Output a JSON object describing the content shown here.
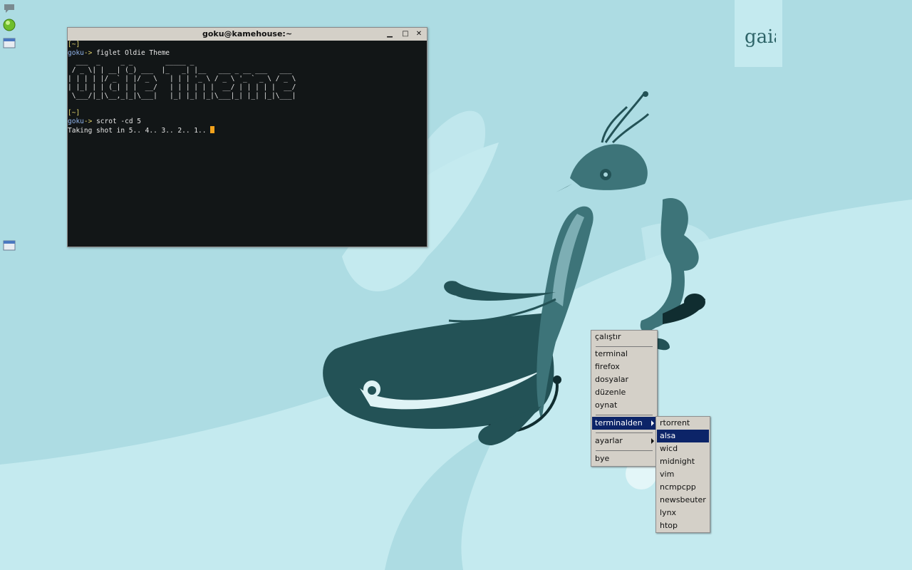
{
  "desktop": {
    "logo_text": "gaia"
  },
  "tray": {
    "icons": [
      "chat-icon",
      "green-orb-icon",
      "window-icon",
      "window-icon"
    ]
  },
  "terminal": {
    "title": "goku@kamehouse:~",
    "buttons": [
      "minimize",
      "maximize",
      "close"
    ],
    "lines": [
      {
        "prompt_dir": "[~]"
      },
      {
        "user": "goku",
        "arrow": "-> ",
        "cmd": "figlet Oldie Theme"
      },
      {
        "text": "  ___  _     _ _        _____ _"
      },
      {
        "text": " / _ \\| | __| (_) ___  |_   _| |__   ___ _ __ ___   ___"
      },
      {
        "text": "| | | | |/ _` | |/ _ \\   | | | '_ \\ / _ \\ '_ ` _ \\ / _ \\"
      },
      {
        "text": "| |_| | | (_| | |  __/   | | | | | |  __/ | | | | |  __/"
      },
      {
        "text": " \\___/|_|\\__,_|_|\\___|   |_| |_| |_|\\___|_| |_| |_|\\___|"
      },
      {
        "text": ""
      },
      {
        "prompt_dir": "[~]"
      },
      {
        "user": "goku",
        "arrow": "-> ",
        "cmd": "scrot -cd 5"
      },
      {
        "text": "Taking shot in 5.. 4.. 3.. 2.. 1.. "
      }
    ]
  },
  "root_menu": {
    "items": [
      {
        "label": "çalıştır"
      },
      {
        "label": "terminal"
      },
      {
        "label": "firefox"
      },
      {
        "label": "dosyalar"
      },
      {
        "label": "düzenle"
      },
      {
        "label": "oynat"
      },
      {
        "label": "terminalden",
        "submenu": true,
        "selected": true
      },
      {
        "label": "ayarlar",
        "submenu": true
      },
      {
        "label": "bye"
      }
    ]
  },
  "sub_menu": {
    "items": [
      {
        "label": "rtorrent"
      },
      {
        "label": "alsa",
        "selected": true
      },
      {
        "label": "wicd"
      },
      {
        "label": "midnight"
      },
      {
        "label": "vim"
      },
      {
        "label": "ncmpcpp"
      },
      {
        "label": "newsbeuter"
      },
      {
        "label": "lynx"
      },
      {
        "label": "htop"
      }
    ]
  },
  "colors": {
    "wallpaper_base": "#addce3",
    "wallpaper_light": "#c4eaef",
    "bird_dark": "#235256",
    "bird_mid": "#3d7479",
    "menu_bg": "#d4d0c8",
    "menu_selected": "#0c2468",
    "terminal_bg": "#121617",
    "cursor": "#f2a21c"
  }
}
